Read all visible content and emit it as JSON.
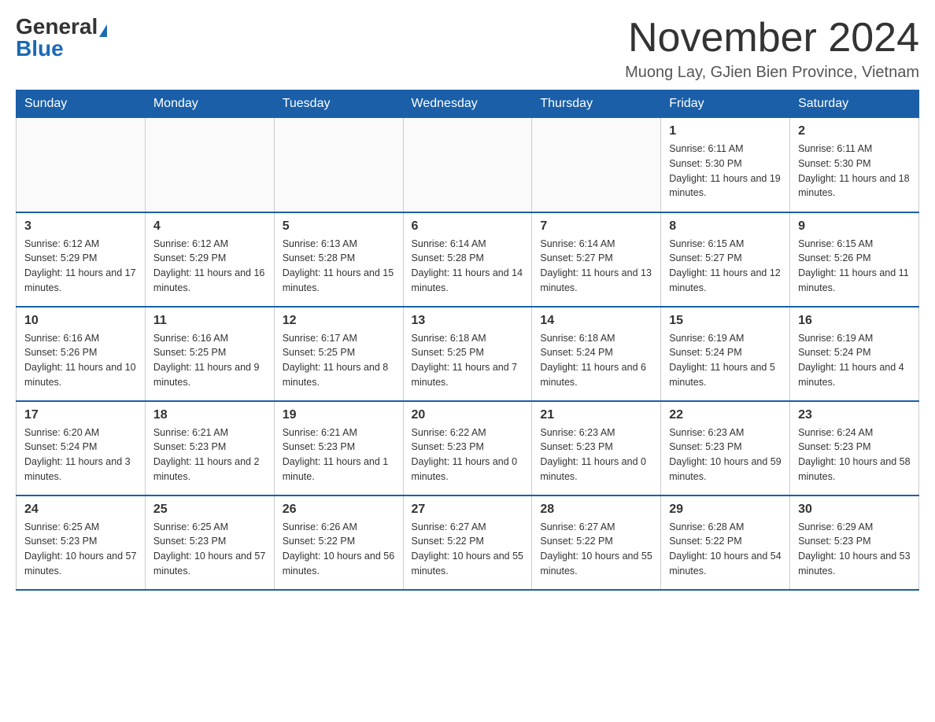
{
  "header": {
    "logo_general": "General",
    "logo_blue": "Blue",
    "month_title": "November 2024",
    "location": "Muong Lay, GJien Bien Province, Vietnam"
  },
  "weekdays": [
    "Sunday",
    "Monday",
    "Tuesday",
    "Wednesday",
    "Thursday",
    "Friday",
    "Saturday"
  ],
  "weeks": [
    [
      {
        "day": "",
        "info": ""
      },
      {
        "day": "",
        "info": ""
      },
      {
        "day": "",
        "info": ""
      },
      {
        "day": "",
        "info": ""
      },
      {
        "day": "",
        "info": ""
      },
      {
        "day": "1",
        "info": "Sunrise: 6:11 AM\nSunset: 5:30 PM\nDaylight: 11 hours and 19 minutes."
      },
      {
        "day": "2",
        "info": "Sunrise: 6:11 AM\nSunset: 5:30 PM\nDaylight: 11 hours and 18 minutes."
      }
    ],
    [
      {
        "day": "3",
        "info": "Sunrise: 6:12 AM\nSunset: 5:29 PM\nDaylight: 11 hours and 17 minutes."
      },
      {
        "day": "4",
        "info": "Sunrise: 6:12 AM\nSunset: 5:29 PM\nDaylight: 11 hours and 16 minutes."
      },
      {
        "day": "5",
        "info": "Sunrise: 6:13 AM\nSunset: 5:28 PM\nDaylight: 11 hours and 15 minutes."
      },
      {
        "day": "6",
        "info": "Sunrise: 6:14 AM\nSunset: 5:28 PM\nDaylight: 11 hours and 14 minutes."
      },
      {
        "day": "7",
        "info": "Sunrise: 6:14 AM\nSunset: 5:27 PM\nDaylight: 11 hours and 13 minutes."
      },
      {
        "day": "8",
        "info": "Sunrise: 6:15 AM\nSunset: 5:27 PM\nDaylight: 11 hours and 12 minutes."
      },
      {
        "day": "9",
        "info": "Sunrise: 6:15 AM\nSunset: 5:26 PM\nDaylight: 11 hours and 11 minutes."
      }
    ],
    [
      {
        "day": "10",
        "info": "Sunrise: 6:16 AM\nSunset: 5:26 PM\nDaylight: 11 hours and 10 minutes."
      },
      {
        "day": "11",
        "info": "Sunrise: 6:16 AM\nSunset: 5:25 PM\nDaylight: 11 hours and 9 minutes."
      },
      {
        "day": "12",
        "info": "Sunrise: 6:17 AM\nSunset: 5:25 PM\nDaylight: 11 hours and 8 minutes."
      },
      {
        "day": "13",
        "info": "Sunrise: 6:18 AM\nSunset: 5:25 PM\nDaylight: 11 hours and 7 minutes."
      },
      {
        "day": "14",
        "info": "Sunrise: 6:18 AM\nSunset: 5:24 PM\nDaylight: 11 hours and 6 minutes."
      },
      {
        "day": "15",
        "info": "Sunrise: 6:19 AM\nSunset: 5:24 PM\nDaylight: 11 hours and 5 minutes."
      },
      {
        "day": "16",
        "info": "Sunrise: 6:19 AM\nSunset: 5:24 PM\nDaylight: 11 hours and 4 minutes."
      }
    ],
    [
      {
        "day": "17",
        "info": "Sunrise: 6:20 AM\nSunset: 5:24 PM\nDaylight: 11 hours and 3 minutes."
      },
      {
        "day": "18",
        "info": "Sunrise: 6:21 AM\nSunset: 5:23 PM\nDaylight: 11 hours and 2 minutes."
      },
      {
        "day": "19",
        "info": "Sunrise: 6:21 AM\nSunset: 5:23 PM\nDaylight: 11 hours and 1 minute."
      },
      {
        "day": "20",
        "info": "Sunrise: 6:22 AM\nSunset: 5:23 PM\nDaylight: 11 hours and 0 minutes."
      },
      {
        "day": "21",
        "info": "Sunrise: 6:23 AM\nSunset: 5:23 PM\nDaylight: 11 hours and 0 minutes."
      },
      {
        "day": "22",
        "info": "Sunrise: 6:23 AM\nSunset: 5:23 PM\nDaylight: 10 hours and 59 minutes."
      },
      {
        "day": "23",
        "info": "Sunrise: 6:24 AM\nSunset: 5:23 PM\nDaylight: 10 hours and 58 minutes."
      }
    ],
    [
      {
        "day": "24",
        "info": "Sunrise: 6:25 AM\nSunset: 5:23 PM\nDaylight: 10 hours and 57 minutes."
      },
      {
        "day": "25",
        "info": "Sunrise: 6:25 AM\nSunset: 5:23 PM\nDaylight: 10 hours and 57 minutes."
      },
      {
        "day": "26",
        "info": "Sunrise: 6:26 AM\nSunset: 5:22 PM\nDaylight: 10 hours and 56 minutes."
      },
      {
        "day": "27",
        "info": "Sunrise: 6:27 AM\nSunset: 5:22 PM\nDaylight: 10 hours and 55 minutes."
      },
      {
        "day": "28",
        "info": "Sunrise: 6:27 AM\nSunset: 5:22 PM\nDaylight: 10 hours and 55 minutes."
      },
      {
        "day": "29",
        "info": "Sunrise: 6:28 AM\nSunset: 5:22 PM\nDaylight: 10 hours and 54 minutes."
      },
      {
        "day": "30",
        "info": "Sunrise: 6:29 AM\nSunset: 5:23 PM\nDaylight: 10 hours and 53 minutes."
      }
    ]
  ]
}
